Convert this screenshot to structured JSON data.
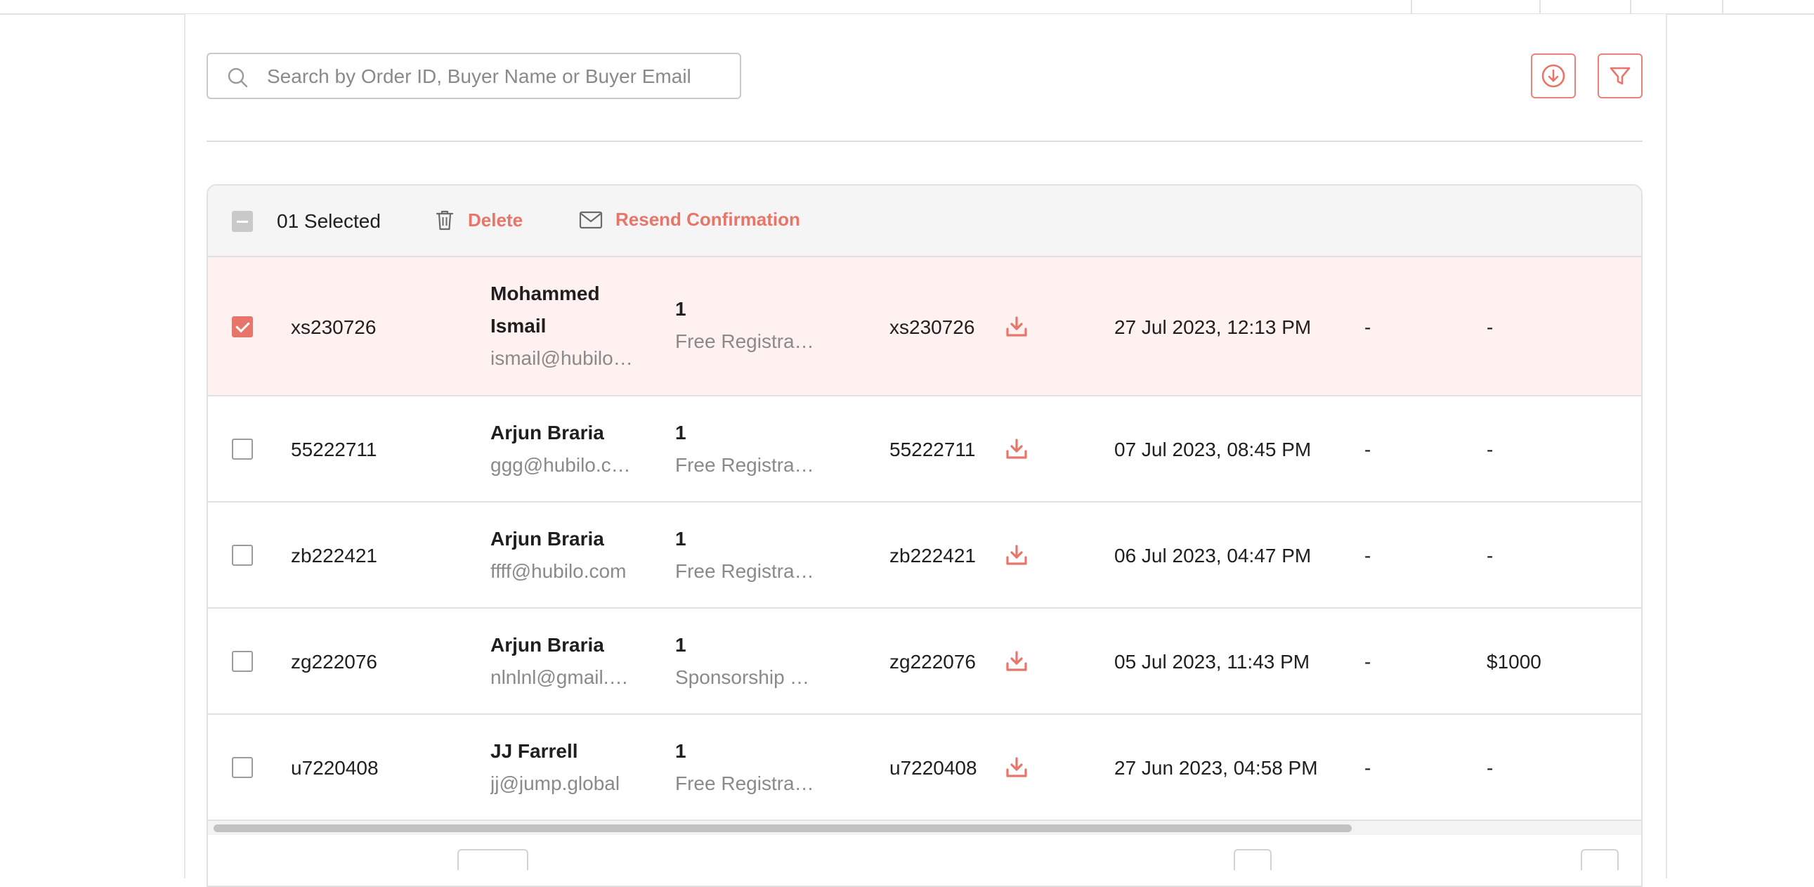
{
  "search": {
    "placeholder": "Search by Order ID, Buyer Name or Buyer Email",
    "icon": "search-icon"
  },
  "toolbar": {
    "download_icon": "download-circle-icon",
    "filter_icon": "filter-icon"
  },
  "selection_bar": {
    "count_label": "01 Selected",
    "delete_label": "Delete",
    "resend_label": "Resend Confirmation"
  },
  "colors": {
    "accent": "#e8756a",
    "selected_row": "#fff1ef",
    "header_bg": "#f5f5f5"
  },
  "rows": [
    {
      "order_id": "xs230726",
      "buyer_name_1": "Mohammed",
      "buyer_name_2": "Ismail",
      "buyer_email": "ismail@hubilo.com",
      "qty": "1",
      "ticket": "Free Registration",
      "ref": "xs230726",
      "date": "27 Jul 2023, 12:13 PM",
      "col_a": "-",
      "col_b": "-",
      "selected": true
    },
    {
      "order_id": "55222711",
      "buyer_name_1": "Arjun Braria",
      "buyer_email": "ggg@hubilo.com",
      "qty": "1",
      "ticket": "Free Registration",
      "ref": "55222711",
      "date": "07 Jul 2023, 08:45 PM",
      "col_a": "-",
      "col_b": "-",
      "selected": false
    },
    {
      "order_id": "zb222421",
      "buyer_name_1": "Arjun Braria",
      "buyer_email": "ffff@hubilo.com",
      "qty": "1",
      "ticket": "Free Registration",
      "ref": "zb222421",
      "date": "06 Jul 2023, 04:47 PM",
      "col_a": "-",
      "col_b": "-",
      "selected": false
    },
    {
      "order_id": "zg222076",
      "buyer_name_1": "Arjun Braria",
      "buyer_email": "nlnlnl@gmail.com",
      "qty": "1",
      "ticket": "Sponsorship Ticket",
      "ref": "zg222076",
      "date": "05 Jul 2023, 11:43 PM",
      "col_a": "-",
      "col_b": "$1000",
      "selected": false
    },
    {
      "order_id": "u7220408",
      "buyer_name_1": "JJ Farrell",
      "buyer_email": "jj@jump.global",
      "qty": "1",
      "ticket": "Free Registration",
      "ref": "u7220408",
      "date": "27 Jun 2023, 04:58 PM",
      "col_a": "-",
      "col_b": "-",
      "selected": false
    }
  ]
}
